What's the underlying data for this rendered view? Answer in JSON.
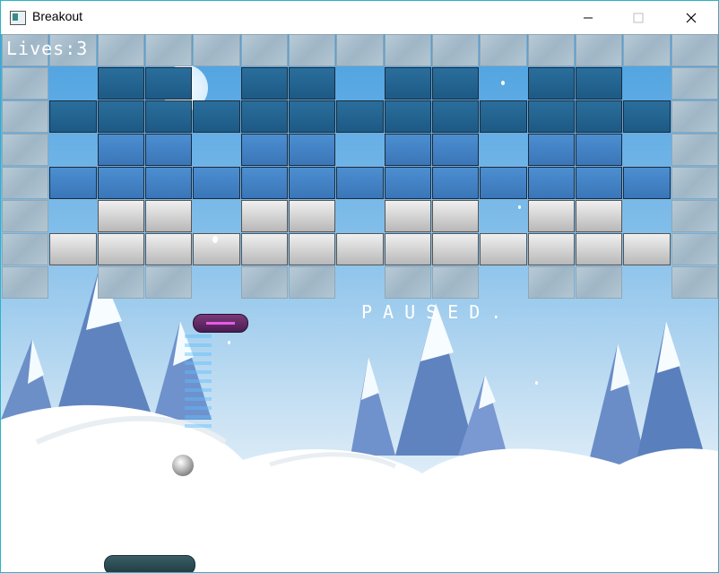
{
  "window": {
    "title": "Breakout",
    "controls": [
      "minimize",
      "maximize",
      "close"
    ]
  },
  "hud": {
    "lives_text": "Lives:3",
    "paused_text": "PAUSED."
  },
  "colors": {
    "sky_top": "#4aa0e0",
    "brick_solid": "#a9bfcd",
    "brick_dark_blue": "#2a6e9c",
    "brick_mid_blue": "#4c8fd1",
    "brick_silver": "#d0d0d0",
    "powerup": "#6a2f6f",
    "paddle": "#2a4a52"
  },
  "level": {
    "columns": 15,
    "rows": [
      "SSSSSSSSSSSSSSS",
      "S.DD.DD.DD.DD.S",
      "SDDDDDDDDDDDDDS",
      "S.MM.MM.MM.MM.S",
      "SMMMMMMMMMMMMMS",
      "S.GG.GG.GG.GG.S",
      "SGGGGGGGGGGGGGS",
      "S.SS.SS.SS.SS.S"
    ],
    "legend": {
      "S": "solid block",
      "D": "dark blue brick",
      "M": "blue brick",
      "G": "silver brick",
      ".": "empty"
    }
  }
}
